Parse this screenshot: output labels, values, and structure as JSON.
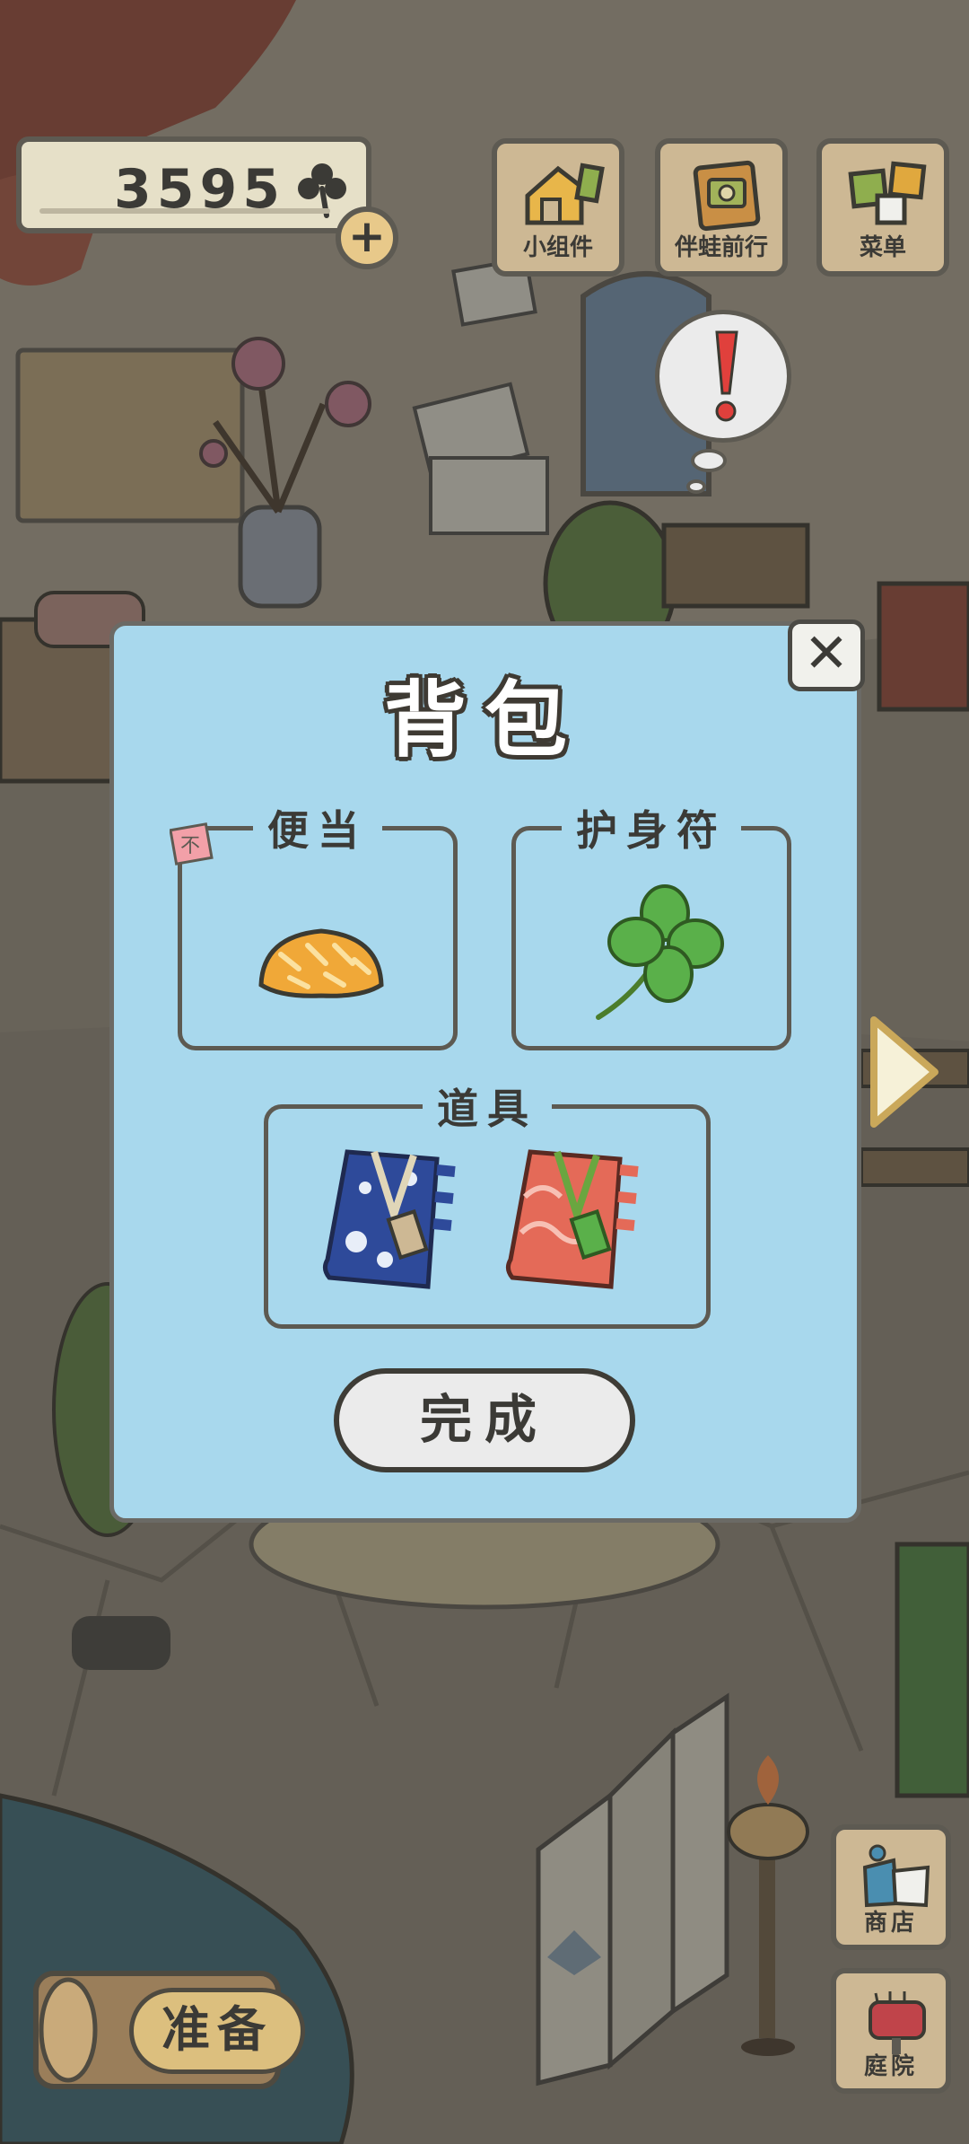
{
  "currency": {
    "amount": "3595",
    "icon": "clover-icon"
  },
  "top_buttons": [
    {
      "label": "小组件",
      "icon": "widget-icon"
    },
    {
      "label": "伴蛙前行",
      "icon": "journey-icon"
    },
    {
      "label": "菜单",
      "icon": "menu-icon"
    }
  ],
  "notification": {
    "symbol": "!"
  },
  "dialog": {
    "title": "背包",
    "slots": {
      "bento": {
        "label": "便当",
        "item": "pineapple-bun",
        "tag": "不"
      },
      "charm": {
        "label": "护身符",
        "item": "four-leaf-clover"
      },
      "tools": {
        "label": "道具",
        "items": [
          "blue-flower-bundle",
          "red-wave-bundle"
        ]
      }
    },
    "done_label": "完成",
    "close_symbol": "✕"
  },
  "bottom": {
    "prepare_label": "准备",
    "shop_label": "商店",
    "garden_label": "庭院"
  },
  "colors": {
    "dialog_bg": "#a8d8ed",
    "button_wood": "#cdb894"
  }
}
